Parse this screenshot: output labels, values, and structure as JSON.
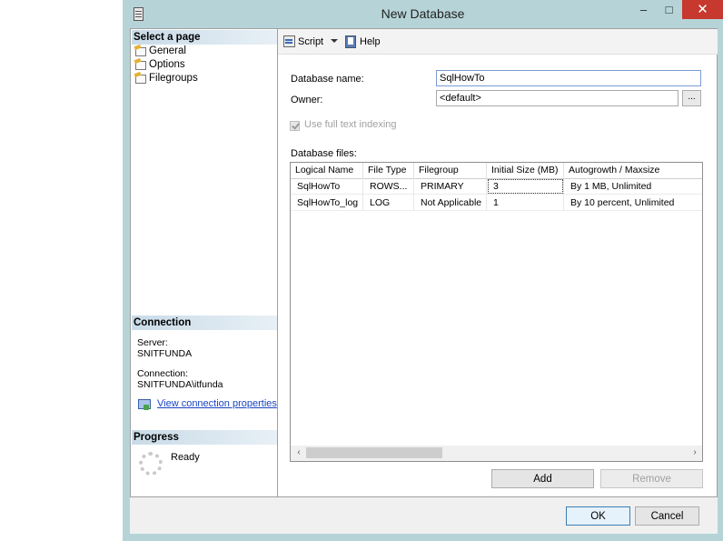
{
  "window": {
    "title": "New Database",
    "minimize_glyph": "–",
    "maximize_glyph": "□",
    "close_glyph": "✕"
  },
  "left_pane": {
    "select_page_header": "Select a page",
    "pages": [
      {
        "label": "General",
        "icon": "page-icon"
      },
      {
        "label": "Options",
        "icon": "page-icon"
      },
      {
        "label": "Filegroups",
        "icon": "page-icon"
      }
    ],
    "connection_header": "Connection",
    "server_label": "Server:",
    "server_value": "SNITFUNDA",
    "connection_label": "Connection:",
    "connection_value": "SNITFUNDA\\itfunda",
    "view_connection_link": "View connection properties",
    "progress_header": "Progress",
    "progress_status": "Ready"
  },
  "toolbar": {
    "script_label": "Script",
    "help_label": "Help"
  },
  "form": {
    "db_name_label": "Database name:",
    "db_name_value": "SqlHowTo",
    "owner_label": "Owner:",
    "owner_value": "<default>",
    "browse_label": "...",
    "fulltext_label": "Use full text indexing",
    "fulltext_checked": true,
    "files_label": "Database files:"
  },
  "files_grid": {
    "columns": [
      "Logical Name",
      "File Type",
      "Filegroup",
      "Initial Size (MB)",
      "Autogrowth / Maxsize"
    ],
    "rows": [
      [
        "SqlHowTo",
        "ROWS...",
        "PRIMARY",
        "3",
        "By 1 MB, Unlimited"
      ],
      [
        "SqlHowTo_log",
        "LOG",
        "Not Applicable",
        "1",
        "By 10 percent, Unlimited"
      ]
    ],
    "scroll_left": "‹",
    "scroll_right": "›"
  },
  "buttons": {
    "add": "Add",
    "remove": "Remove",
    "ok": "OK",
    "cancel": "Cancel"
  }
}
